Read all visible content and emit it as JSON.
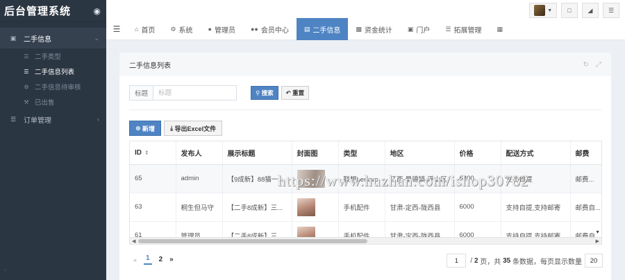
{
  "brand": {
    "title": "后台管理系统",
    "icon": "water-drop-icon"
  },
  "sidebar": {
    "group": {
      "label": "二手信息",
      "icon": "list-icon",
      "arrow": "⌄"
    },
    "sub_items": [
      {
        "label": "二手类型",
        "icon": "list-icon"
      },
      {
        "label": "二手信息列表",
        "icon": "list-icon"
      },
      {
        "label": "二手信息待审核",
        "icon": "gear-icon"
      },
      {
        "label": "已出售",
        "icon": "gavel-icon"
      }
    ],
    "order_menu": {
      "label": "订单管理",
      "icon": "list-icon",
      "arrow": "‹"
    },
    "bottom_arrow": "›"
  },
  "topnav": {
    "items": [
      {
        "label": "首页",
        "icon": "home-icon"
      },
      {
        "label": "系统",
        "icon": "gear-icon"
      },
      {
        "label": "管理员",
        "icon": "user-icon"
      },
      {
        "label": "会员中心",
        "icon": "users-icon"
      },
      {
        "label": "二手信息",
        "icon": "card-icon"
      },
      {
        "label": "资金统计",
        "icon": "bar-chart-icon"
      },
      {
        "label": "门户",
        "icon": "window-icon"
      },
      {
        "label": "拓展管理",
        "icon": "list-icon"
      },
      {
        "label": "",
        "icon": "grid-icon"
      }
    ]
  },
  "panel": {
    "title": "二手信息列表"
  },
  "search": {
    "label": "标题",
    "placeholder": "标题",
    "search_label": "搜索",
    "reset_label": "重置"
  },
  "toolbar": {
    "add_label": "新增",
    "export_label": "导出Excel文件"
  },
  "table": {
    "columns": [
      "ID",
      "发布人",
      "展示标题",
      "封面图",
      "类型",
      "地区",
      "价格",
      "配送方式",
      "邮费"
    ],
    "rows": [
      {
        "id": "65",
        "publisher": "admin",
        "title": "【9成新】88猫一...",
        "type": "联想Lenovo",
        "region": "江西-景德镇-浮山区",
        "price": "6300",
        "delivery": "支持自提",
        "postage": "邮费..."
      },
      {
        "id": "63",
        "publisher": "桐生但马守",
        "title": "【二手8成新】三...",
        "type": "手机配件",
        "region": "甘肃-定西-陇西县",
        "price": "6000",
        "delivery": "支持自提,支持邮寄",
        "postage": "邮费自..."
      },
      {
        "id": "61",
        "publisher": "管理员",
        "title": "【二手8成新】三...",
        "type": "手机配件",
        "region": "甘肃-定西-陇西县",
        "price": "6000",
        "delivery": "支持自提,支持邮寄",
        "postage": "邮费自..."
      }
    ]
  },
  "watermark": "https://www.huzhan.com/ishop30782",
  "pagination": {
    "prev": "«",
    "next": "»",
    "pages": [
      "1",
      "2"
    ],
    "current": "1",
    "goto_value": "1",
    "summary_prefix": "/ ",
    "total_pages": "2",
    "summary_mid1": " 页，共 ",
    "total_items": "35",
    "summary_mid2": " 条数据，每页显示数量",
    "page_size": "20"
  },
  "colors": {
    "primary": "#4f84c4",
    "sidebar_bg": "#2b3643"
  }
}
